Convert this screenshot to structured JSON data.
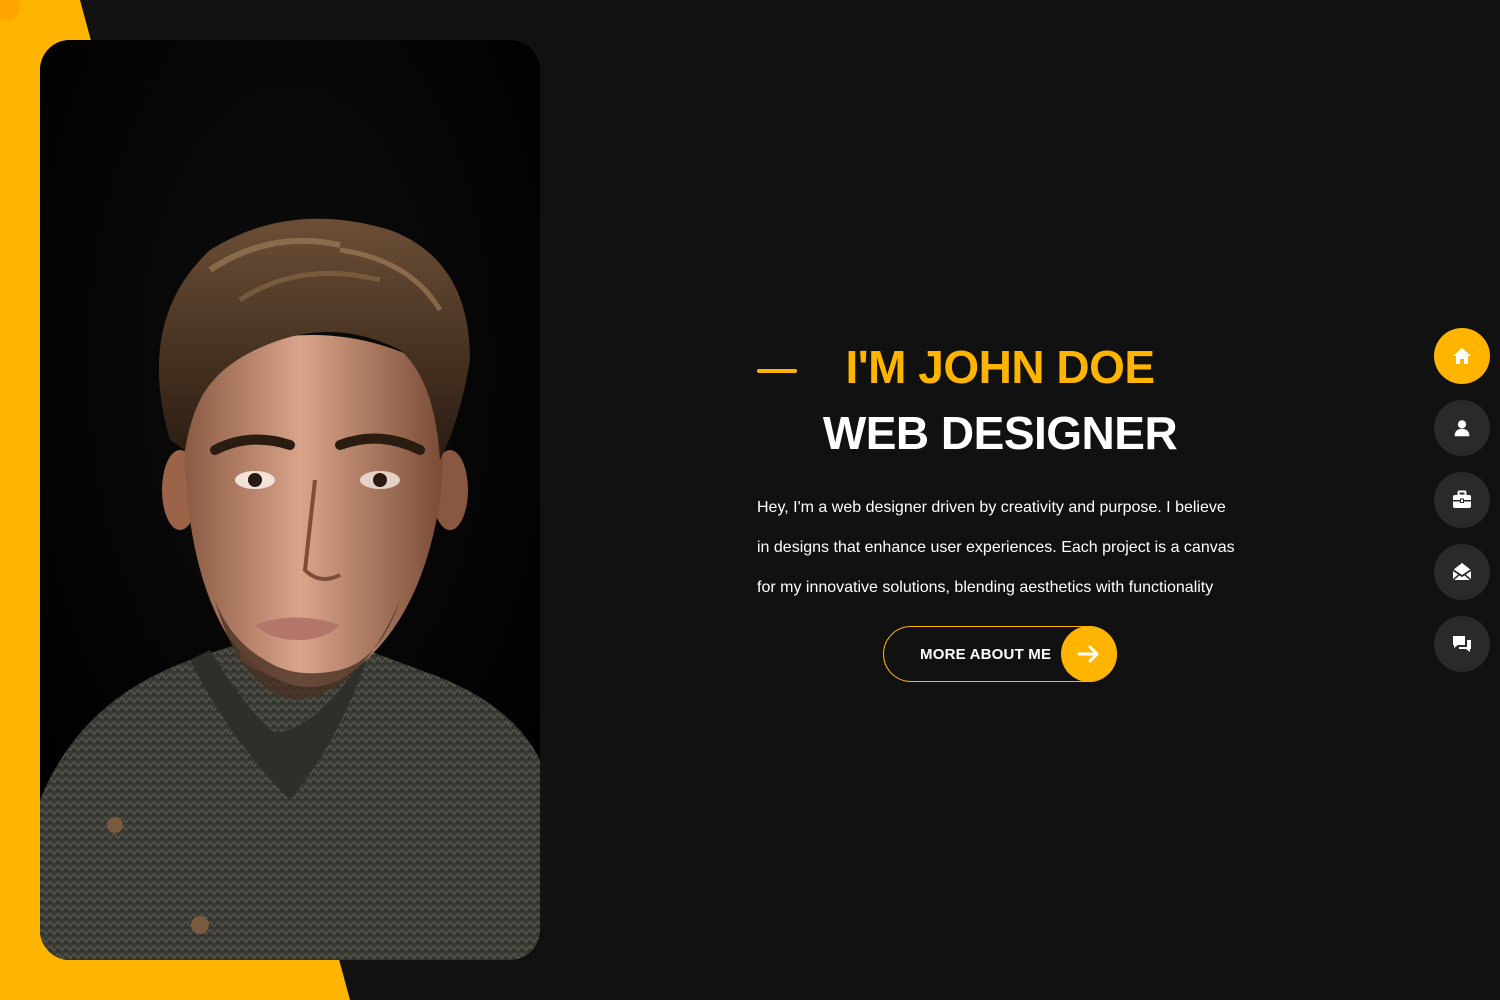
{
  "colors": {
    "accent": "#ffb400",
    "background": "#111111",
    "nav_button": "#2b2a2a",
    "text": "#ffffff"
  },
  "hero": {
    "greeting": "I'M JOHN DOE",
    "role": "WEB DESIGNER",
    "bio_lines": [
      "Hey, I'm a web designer driven by creativity and purpose. I believe",
      "in designs that enhance user experiences. Each project is a canvas",
      "for my innovative solutions, blending aesthetics with functionality"
    ],
    "cta_label": "MORE ABOUT ME",
    "cta_icon": "arrow-right-icon"
  },
  "profile_photo": {
    "subject": "portrait-photo"
  },
  "side_nav": {
    "items": [
      {
        "icon": "home-icon",
        "active": true
      },
      {
        "icon": "user-icon",
        "active": false
      },
      {
        "icon": "briefcase-icon",
        "active": false
      },
      {
        "icon": "envelope-icon",
        "active": false
      },
      {
        "icon": "chat-icon",
        "active": false
      }
    ]
  }
}
